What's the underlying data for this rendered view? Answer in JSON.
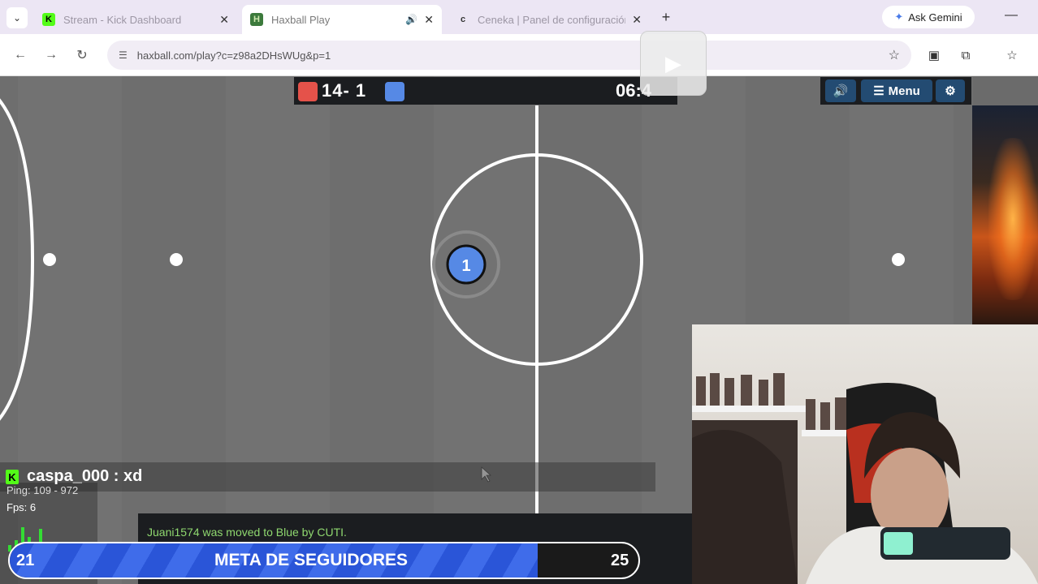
{
  "browser": {
    "tabs": [
      {
        "title": "Stream - Kick Dashboard",
        "favicon": "kick-logo-icon"
      },
      {
        "title": "Haxball Play",
        "favicon": "haxball-icon",
        "audio": true,
        "active": true
      },
      {
        "title": "Ceneka | Panel de configuración",
        "favicon": "ceneka-icon"
      }
    ],
    "gemini_label": "Ask Gemini",
    "url": "haxball.com/play?c=z98a2DHsWUg&p=1"
  },
  "game": {
    "score": "14- 1",
    "clock": "06:4",
    "red_color": "#e5524a",
    "blue_color": "#5689e5",
    "player_number": "1",
    "menu_label": "Menu"
  },
  "overlay": {
    "chat_user": "caspa_000 : xd",
    "ping": "Ping: 109 - 972",
    "fps": "Fps: 6",
    "server_message": "Juani1574 was moved to Blue by CUTI.",
    "goal": {
      "current": "21",
      "title": "META DE SEGUIDORES",
      "target": "25",
      "progress": 0.84
    }
  }
}
